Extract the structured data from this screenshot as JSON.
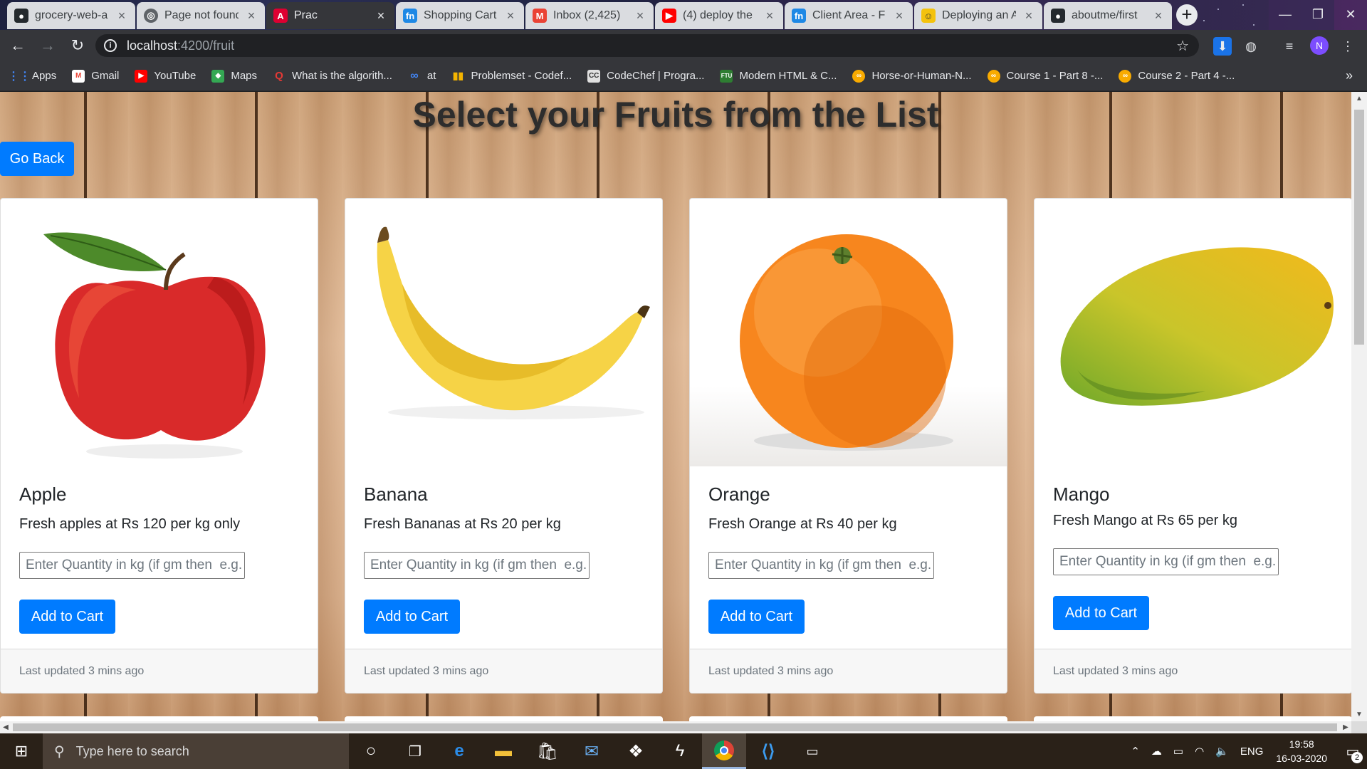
{
  "tabs": [
    {
      "title": "grocery-web-a",
      "icon": "github-icon",
      "color": "#24292e"
    },
    {
      "title": "Page not found",
      "icon": "globe-icon",
      "color": "#5f6368"
    },
    {
      "title": "Prac",
      "icon": "angular-icon",
      "color": "#dd0031"
    },
    {
      "title": "Shopping Cart",
      "icon": "fn-icon",
      "color": "#1e88e5"
    },
    {
      "title": "Inbox (2,425)",
      "icon": "gmail-icon",
      "color": "#ea4335"
    },
    {
      "title": "(4) deploy the",
      "icon": "youtube-icon",
      "color": "#ff0000"
    },
    {
      "title": "Client Area - F",
      "icon": "fn-icon",
      "color": "#1e88e5"
    },
    {
      "title": "Deploying an A",
      "icon": "smiley-icon",
      "color": "#f4c20d"
    },
    {
      "title": "aboutme/first",
      "icon": "github-icon",
      "color": "#24292e"
    }
  ],
  "address": {
    "host": "localhost",
    "path": ":4200/fruit"
  },
  "bookmarks": [
    {
      "label": "Apps",
      "icon": "apps-grid-icon",
      "color": "#4285f4"
    },
    {
      "label": "Gmail",
      "icon": "gmail-icon",
      "color": "#ea4335"
    },
    {
      "label": "YouTube",
      "icon": "youtube-icon",
      "color": "#ff0000"
    },
    {
      "label": "Maps",
      "icon": "maps-icon",
      "color": "#34a853"
    },
    {
      "label": "What is the algorith...",
      "icon": "quora-icon",
      "color": "#b92b27"
    },
    {
      "label": "at",
      "icon": "infinity-icon",
      "color": "#4285f4"
    },
    {
      "label": "Problemset - Codef...",
      "icon": "bar-chart-icon",
      "color": "#1e88e5"
    },
    {
      "label": "CodeChef | Progra...",
      "icon": "codechef-icon",
      "color": "#5b4638"
    },
    {
      "label": "Modern HTML & C...",
      "icon": "ftu-icon",
      "color": "#2e7d32"
    },
    {
      "label": "Horse-or-Human-N...",
      "icon": "colab-icon",
      "color": "#f9ab00"
    },
    {
      "label": "Course 1 - Part 8 -...",
      "icon": "colab-icon",
      "color": "#f9ab00"
    },
    {
      "label": "Course 2 - Part 4 -...",
      "icon": "colab-icon",
      "color": "#f9ab00"
    }
  ],
  "page": {
    "title": "Select your Fruits from the List",
    "go_back": "Go Back"
  },
  "fruits": [
    {
      "name": "Apple",
      "desc": "Fresh apples at Rs 120 per kg only",
      "placeholder": "Enter Quantity in kg (if gm then  e.g.",
      "button": "Add to Cart",
      "footer": "Last updated 3 mins ago"
    },
    {
      "name": "Banana",
      "desc": "Fresh Bananas at Rs 20 per kg",
      "placeholder": "Enter Quantity in kg (if gm then  e.g.",
      "button": "Add to Cart",
      "footer": "Last updated 3 mins ago"
    },
    {
      "name": "Orange",
      "desc": "Fresh Orange at Rs 40 per kg",
      "placeholder": "Enter Quantity in kg (if gm then  e.g.",
      "button": "Add to Cart",
      "footer": "Last updated 3 mins ago"
    },
    {
      "name": "Mango",
      "desc": "Fresh Mango at Rs 65 per kg",
      "placeholder": "Enter Quantity in kg (if gm then  e.g.",
      "button": "Add to Cart",
      "footer": "Last updated 3 mins ago"
    }
  ],
  "taskbar": {
    "search_placeholder": "Type here to search",
    "language": "ENG",
    "time": "19:58",
    "date": "16-03-2020",
    "notifications": "2"
  },
  "colors": {
    "primary": "#007bff",
    "card_footer": "#f7f7f7"
  }
}
